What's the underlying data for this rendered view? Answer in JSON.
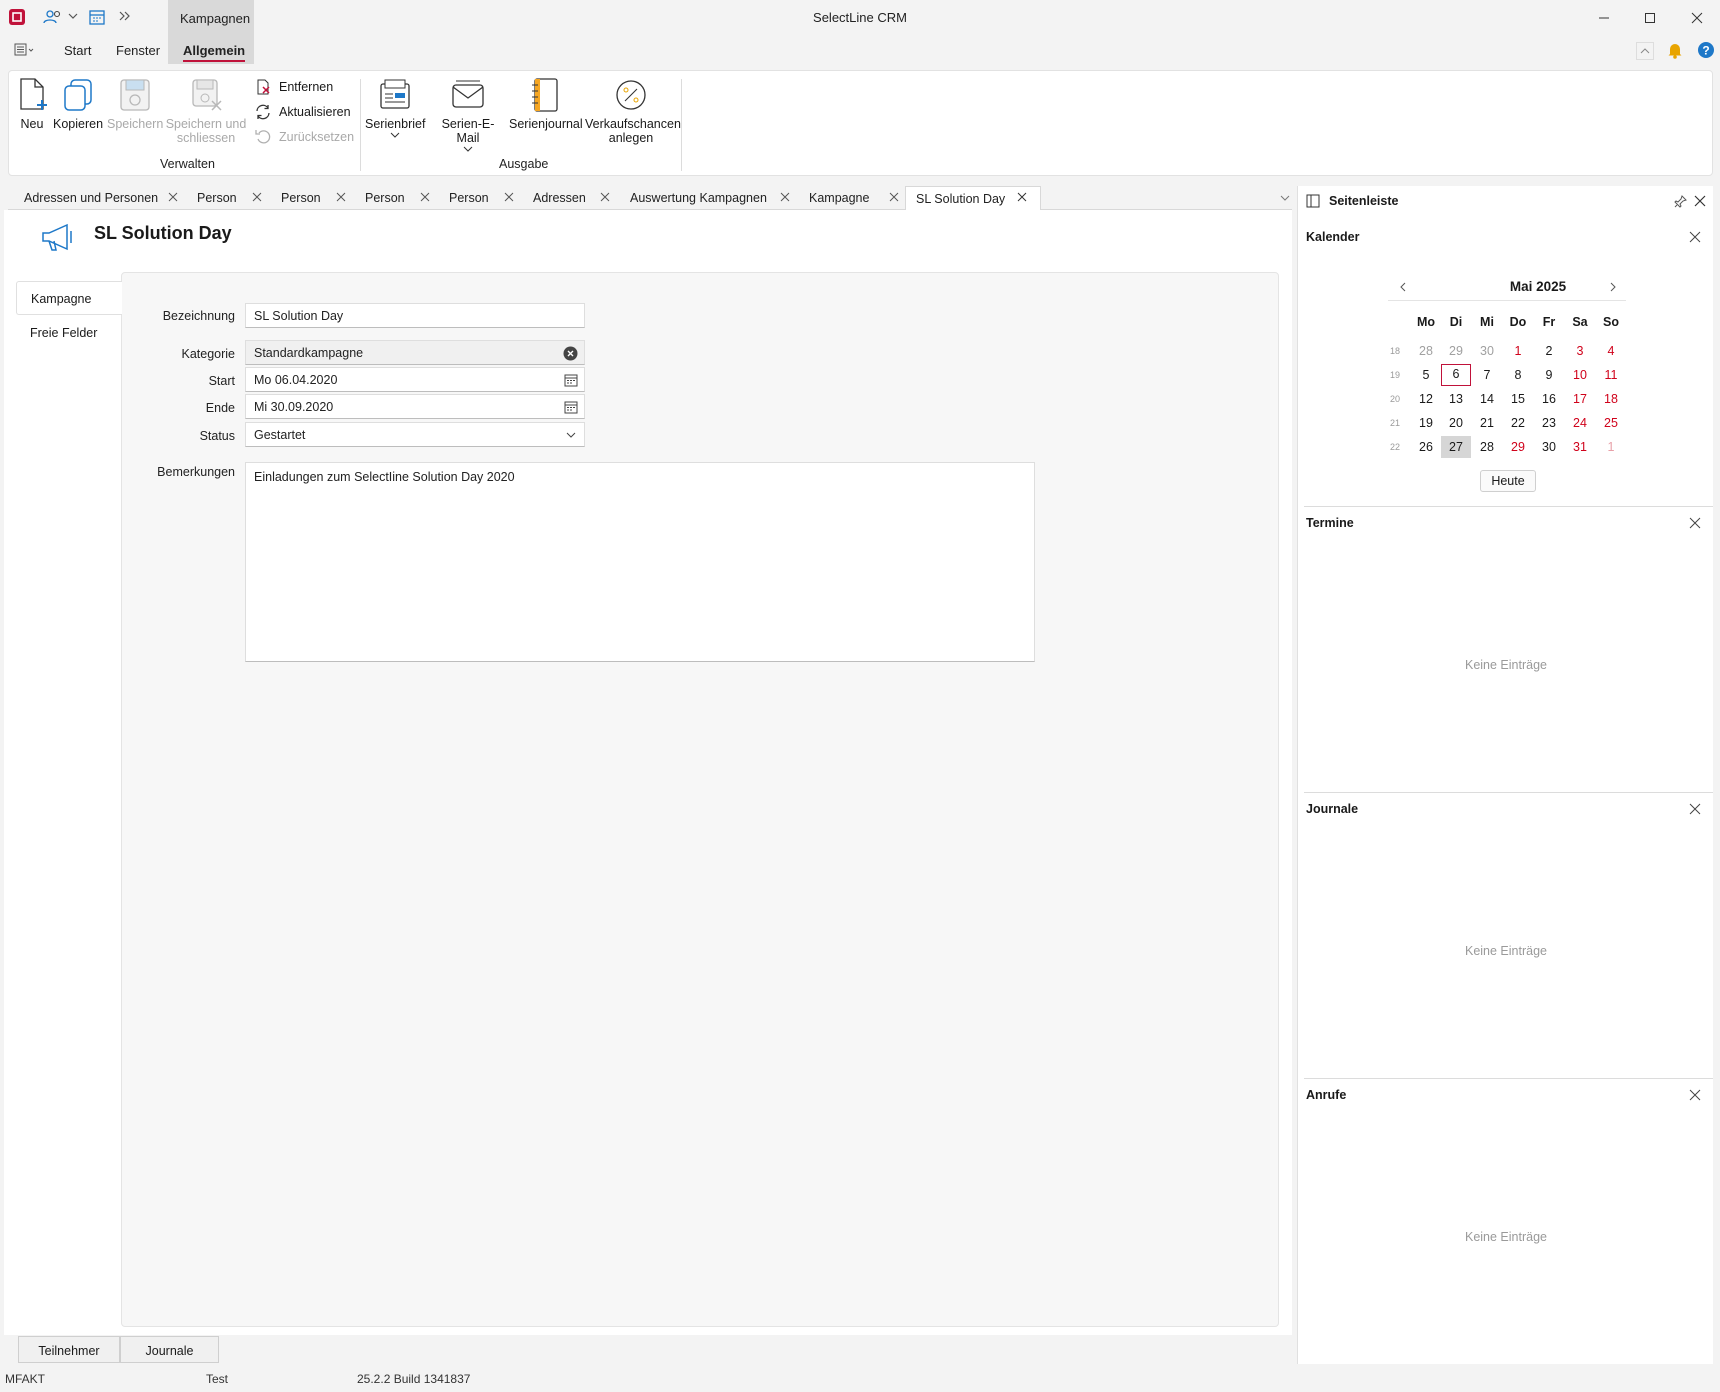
{
  "app": {
    "title": "SelectLine CRM",
    "context_tab": "Kampagnen"
  },
  "ribbon_tabs": [
    "Start",
    "Fenster",
    "Allgemein"
  ],
  "ribbon": {
    "buttons": {
      "neu": "Neu",
      "kopieren": "Kopieren",
      "speichern": "Speichern",
      "speichern_schliessen_1": "Speichern und",
      "speichern_schliessen_2": "schliessen",
      "entfernen": "Entfernen",
      "aktualisieren": "Aktualisieren",
      "zuruecksetzen": "Zurücksetzen",
      "serienbrief": "Serienbrief",
      "serienemail": "Serien-E-Mail",
      "serienjournal": "Serienjournal",
      "verkauf_1": "Verkaufschancen",
      "verkauf_2": "anlegen"
    },
    "groups": {
      "verwalten": "Verwalten",
      "ausgabe": "Ausgabe"
    }
  },
  "doc_tabs": [
    "Adressen und Personen",
    "Person",
    "Person",
    "Person",
    "Person",
    "Adressen",
    "Auswertung Kampagnen",
    "Kampagne",
    "SL Solution Day"
  ],
  "record": {
    "title": "SL Solution Day"
  },
  "side_tabs": [
    "Kampagne",
    "Freie Felder"
  ],
  "form": {
    "labels": {
      "bezeichnung": "Bezeichnung",
      "kategorie": "Kategorie",
      "start": "Start",
      "ende": "Ende",
      "status": "Status",
      "bemerkungen": "Bemerkungen"
    },
    "values": {
      "bezeichnung": "SL Solution Day",
      "kategorie": "Standardkampagne",
      "start": "Mo 06.04.2020",
      "ende": "Mi 30.09.2020",
      "status": "Gestartet",
      "bemerkungen": "Einladungen zum SelectIine Solution Day 2020"
    }
  },
  "bottom_tabs": [
    "Teilnehmer",
    "Journale"
  ],
  "statusbar": {
    "left": "MFAKT",
    "mid": "Test",
    "version": "25.2.2 Build 1341837"
  },
  "sidebar": {
    "title": "Seitenleiste",
    "calendar": {
      "title": "Kalender",
      "month": "Mai 2025",
      "weekdays": [
        "Mo",
        "Di",
        "Mi",
        "Do",
        "Fr",
        "Sa",
        "So"
      ],
      "weeks": [
        {
          "kw": "18",
          "days": [
            "28",
            "29",
            "30",
            "1",
            "2",
            "3",
            "4"
          ]
        },
        {
          "kw": "19",
          "days": [
            "5",
            "6",
            "7",
            "8",
            "9",
            "10",
            "11"
          ]
        },
        {
          "kw": "20",
          "days": [
            "12",
            "13",
            "14",
            "15",
            "16",
            "17",
            "18"
          ]
        },
        {
          "kw": "21",
          "days": [
            "19",
            "20",
            "21",
            "22",
            "23",
            "24",
            "25"
          ]
        },
        {
          "kw": "22",
          "days": [
            "26",
            "27",
            "28",
            "29",
            "30",
            "31",
            "1"
          ]
        }
      ],
      "today_button": "Heute"
    },
    "termine": {
      "title": "Termine",
      "empty": "Keine Einträge"
    },
    "journale": {
      "title": "Journale",
      "empty": "Keine Einträge"
    },
    "anrufe": {
      "title": "Anrufe",
      "empty": "Keine Einträge"
    }
  },
  "colors": {
    "accent": "#c0123a",
    "weekend": "#d0021b",
    "help": "#1e78c8",
    "bell": "#e8a400"
  }
}
